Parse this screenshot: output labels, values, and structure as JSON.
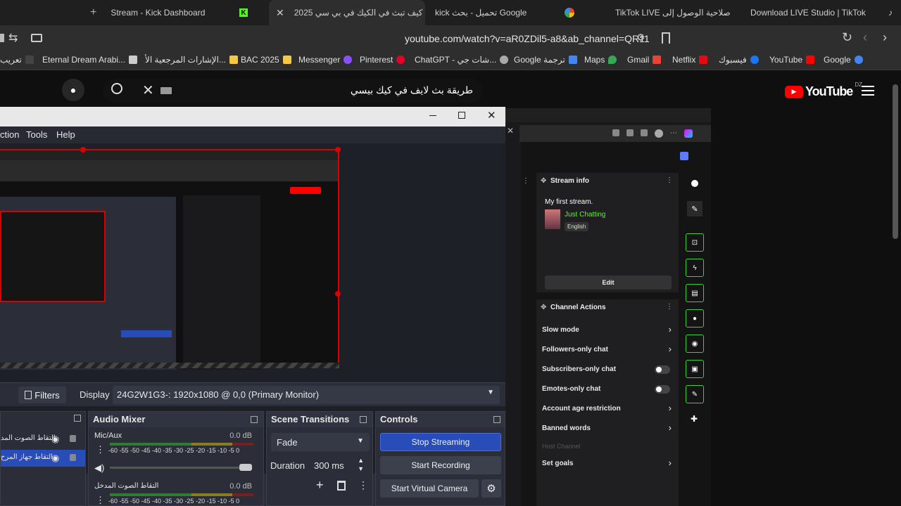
{
  "tabs": [
    {
      "label": "Stream - Kick Dashboard",
      "icon": "plus-icon"
    },
    {
      "label": "كيف تبث في الكيك في بي سي 2025",
      "icon": "youtube-icon"
    },
    {
      "label": "kick تحميل - بحث Google",
      "icon": "google-icon"
    },
    {
      "label": "صلاحية الوصول إلى TikTok LIVE",
      "icon": "tiktok-icon"
    },
    {
      "label": "Download LIVE Studio | TikTok",
      "icon": "tiktok-icon"
    }
  ],
  "address": {
    "url": "youtube.com/watch?v=aR0ZDil5-a8&ab_channel=QR11"
  },
  "bookmarks": [
    "تعريب",
    "Eternal Dream Arabi...",
    "الإشارات المرجعية الأ...",
    "BAC 2025",
    "Messenger",
    "Pinterest",
    "ChatGPT - شات جي...",
    "Google ترجمة",
    "Maps",
    "Gmail",
    "Netflix",
    "فيسبوك",
    "YouTube",
    "Google"
  ],
  "youtube": {
    "search_value": "طريقة بث لايف في كيك بيسي",
    "logo": "YouTube",
    "region": "DZ"
  },
  "obs": {
    "menu": [
      "ction",
      "Tools",
      "Help"
    ],
    "display_label": "Display",
    "display_value": "24G2W1G3-: 1920x1080 @ 0,0 (Primary Monitor)",
    "filters_label": "Filters",
    "sources": [
      "التقاط الصوت المد",
      "التقاط جهاز المرح"
    ],
    "audio_mixer": {
      "title": "Audio Mixer",
      "ch1": "Mic/Aux",
      "ch1_db": "0.0 dB",
      "ch2": "التقاط الصوت المدخل",
      "ch2_db": "0.0 dB",
      "scale": "-60 -55 -50 -45 -40 -35 -30 -25 -20 -15 -10 -5 0"
    },
    "transitions": {
      "title": "Scene Transitions",
      "type": "Fade",
      "duration_label": "Duration",
      "duration": "300 ms"
    },
    "controls": {
      "title": "Controls",
      "stop_streaming": "Stop Streaming",
      "start_recording": "Start Recording",
      "start_virtual": "Start Virtual Camera"
    }
  },
  "kick": {
    "stream_info": "Stream info",
    "title": "My first stream.",
    "category": "Just Chatting",
    "language": "English",
    "edit": "Edit",
    "channel_actions": "Channel Actions",
    "actions": [
      "Slow mode",
      "Followers-only chat",
      "Subscribers-only chat",
      "Emotes-only chat",
      "Account age restriction",
      "Banned words",
      "Host Channel",
      "Set goals"
    ]
  },
  "colors": {
    "accent": "#53fc18",
    "obs_blue": "#284cb8",
    "yt_red": "#ff0000"
  }
}
